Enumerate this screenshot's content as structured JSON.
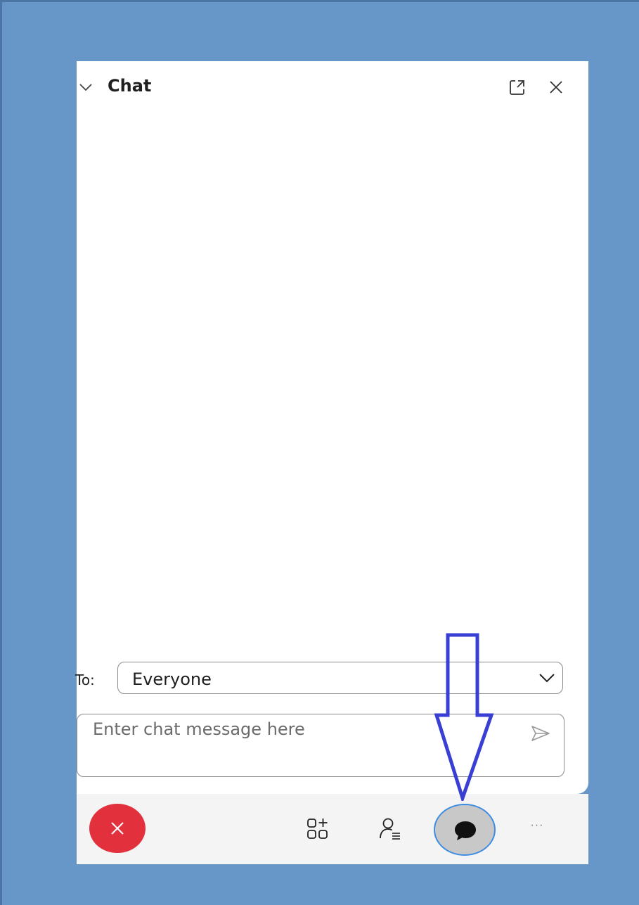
{
  "chat_panel": {
    "title": "Chat",
    "to_label": "To:",
    "to_value": "Everyone",
    "message_placeholder": "Enter chat message here",
    "message_value": ""
  },
  "toolbar": {
    "more_label": "···"
  },
  "icons": {
    "collapse": "chevron-down-icon",
    "popout": "popout-icon",
    "close": "close-icon",
    "dropdown": "chevron-down-icon",
    "send": "send-icon",
    "leave": "leave-call-icon",
    "apps": "apps-icon",
    "participants": "participants-icon",
    "chat": "chat-icon",
    "more": "more-icon"
  },
  "colors": {
    "background": "#6797c8",
    "leave": "#e2303d",
    "chat_active_bg": "#c8c8c8",
    "chat_active_ring": "#3c8ce0",
    "annotation_arrow": "#3a3fd4"
  }
}
